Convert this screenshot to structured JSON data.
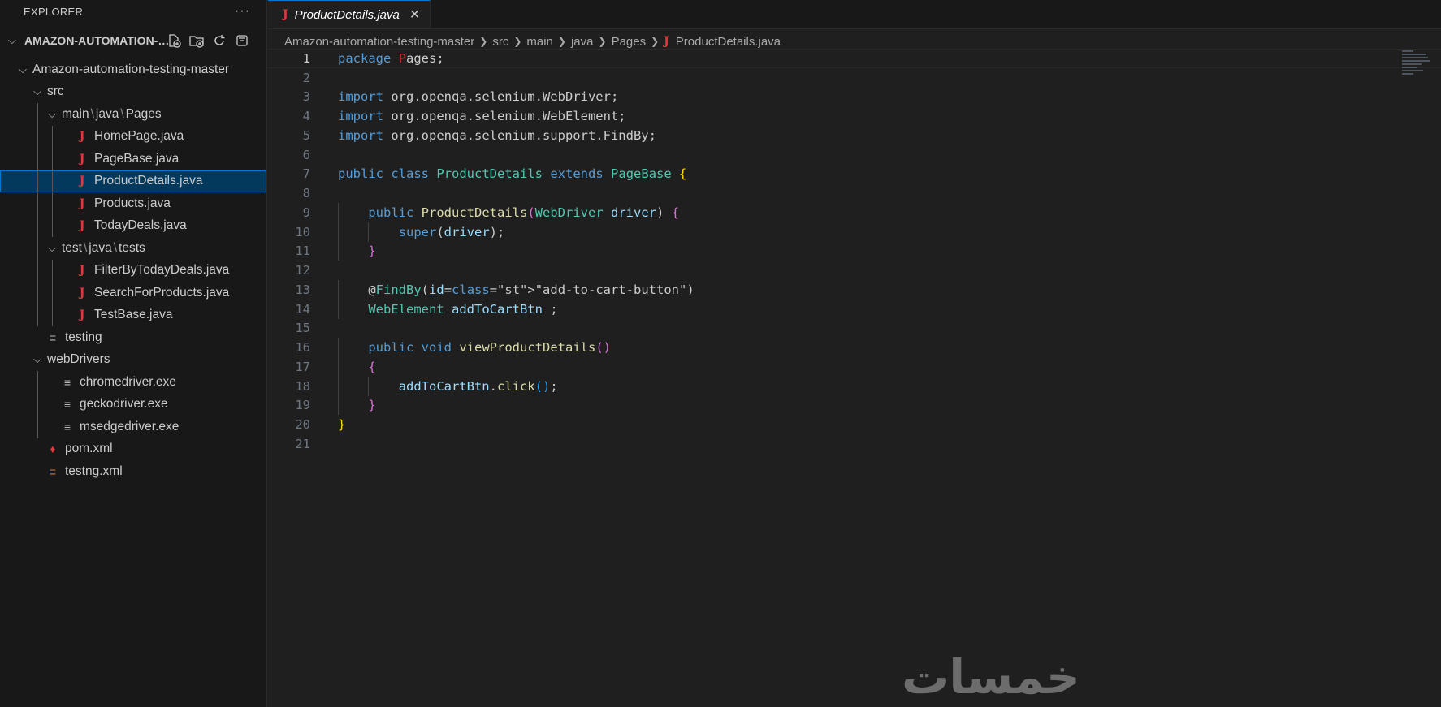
{
  "sidebar": {
    "title": "EXPLORER",
    "more": "···",
    "project": "AMAZON-AUTOMATION-TESTING-MASTER",
    "items": [
      {
        "label": "Amazon-automation-testing-master",
        "type": "folder",
        "depth": 0,
        "expanded": true
      },
      {
        "label": "src",
        "type": "folder",
        "depth": 1,
        "expanded": true
      },
      {
        "label": "main",
        "label2": "java",
        "label3": "Pages",
        "type": "folder",
        "depth": 2,
        "expanded": true
      },
      {
        "label": "HomePage.java",
        "type": "java",
        "depth": 3
      },
      {
        "label": "PageBase.java",
        "type": "java",
        "depth": 3
      },
      {
        "label": "ProductDetails.java",
        "type": "java",
        "depth": 3,
        "selected": true
      },
      {
        "label": "Products.java",
        "type": "java",
        "depth": 3
      },
      {
        "label": "TodayDeals.java",
        "type": "java",
        "depth": 3
      },
      {
        "label": "test",
        "label2": "java",
        "label3": "tests",
        "type": "folder",
        "depth": 2,
        "expanded": true
      },
      {
        "label": "FilterByTodayDeals.java",
        "type": "java",
        "depth": 3
      },
      {
        "label": "SearchForProducts.java",
        "type": "java",
        "depth": 3
      },
      {
        "label": "TestBase.java",
        "type": "java",
        "depth": 3
      },
      {
        "label": "testing",
        "type": "file",
        "depth": 1
      },
      {
        "label": "webDrivers",
        "type": "folder",
        "depth": 1,
        "expanded": true
      },
      {
        "label": "chromedriver.exe",
        "type": "file",
        "depth": 2
      },
      {
        "label": "geckodriver.exe",
        "type": "file",
        "depth": 2
      },
      {
        "label": "msedgedriver.exe",
        "type": "file",
        "depth": 2
      },
      {
        "label": "pom.xml",
        "type": "pom",
        "depth": 1
      },
      {
        "label": "testng.xml",
        "type": "rss",
        "depth": 1
      }
    ]
  },
  "tab": {
    "label": "ProductDetails.java",
    "close": "✕"
  },
  "breadcrumb": [
    "Amazon-automation-testing-master",
    "src",
    "main",
    "java",
    "Pages",
    "ProductDetails.java"
  ],
  "editor": {
    "active_line": 1,
    "lines": [
      "package Pages;",
      "",
      "import org.openqa.selenium.WebDriver;",
      "import org.openqa.selenium.WebElement;",
      "import org.openqa.selenium.support.FindBy;",
      "",
      "public class ProductDetails extends PageBase {",
      "",
      "    public ProductDetails(WebDriver driver) {",
      "        super(driver);",
      "    }",
      "",
      "    @FindBy(id=\"add-to-cart-button\")",
      "    WebElement addToCartBtn ;",
      "",
      "    public void viewProductDetails()",
      "    {",
      "        addToCartBtn.click();",
      "    }",
      "}",
      ""
    ]
  },
  "watermark": "خمسات"
}
